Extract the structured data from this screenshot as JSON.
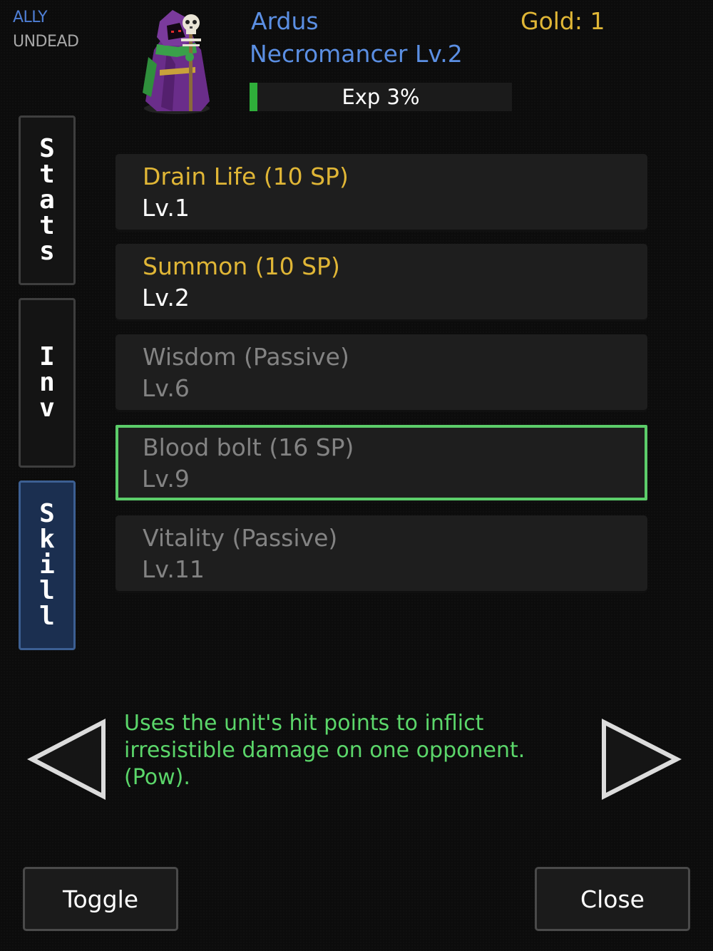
{
  "unit": {
    "allegiance": "ALLY",
    "race": "UNDEAD",
    "name": "Ardus",
    "class_level": "Necromancer Lv.2",
    "portrait": "necromancer-sprite"
  },
  "gold_label": "Gold: 1",
  "exp": {
    "label": "Exp 3%",
    "percent": 3
  },
  "tabs": [
    {
      "label": "Stats",
      "active": false
    },
    {
      "label": "Inv",
      "active": false
    },
    {
      "label": "Skill",
      "active": true
    }
  ],
  "skills": [
    {
      "name": "Drain Life (10 SP)",
      "level": "Lv.1",
      "state": "available"
    },
    {
      "name": "Summon (10 SP)",
      "level": "Lv.2",
      "state": "available"
    },
    {
      "name": "Wisdom (Passive)",
      "level": "Lv.6",
      "state": "locked"
    },
    {
      "name": "Blood bolt (16 SP)",
      "level": "Lv.9",
      "state": "locked-selected"
    },
    {
      "name": "Vitality (Passive)",
      "level": "Lv.11",
      "state": "locked"
    }
  ],
  "description": "Uses the unit's hit points to inflict irresistible damage on one opponent. (Pow).",
  "nav": {
    "prev_icon": "left-arrow-icon",
    "next_icon": "right-arrow-icon"
  },
  "buttons": {
    "toggle": "Toggle",
    "close": "Close"
  },
  "colors": {
    "ally_blue": "#5b8fe3",
    "gold": "#e0b636",
    "selection_green": "#5ccd6a",
    "description_green": "#5bd66a",
    "active_tab": "#1b2f50"
  }
}
